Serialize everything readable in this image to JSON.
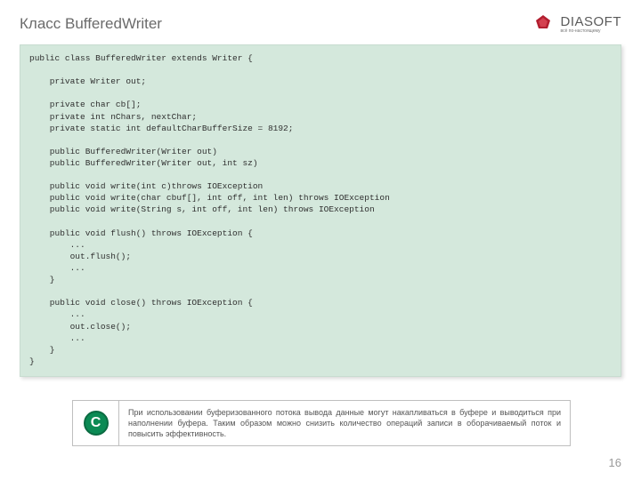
{
  "header": {
    "title": "Класс BufferedWriter",
    "logo_name": "DIASOFT",
    "logo_tagline": "всё по-настоящему"
  },
  "code": {
    "lines": [
      "public class BufferedWriter extends Writer {",
      "",
      "    private Writer out;",
      "",
      "    private char cb[];",
      "    private int nChars, nextChar;",
      "    private static int defaultCharBufferSize = 8192;",
      "",
      "    public BufferedWriter(Writer out)",
      "    public BufferedWriter(Writer out, int sz)",
      "",
      "    public void write(int c)throws IOException",
      "    public void write(char cbuf[], int off, int len) throws IOException",
      "    public void write(String s, int off, int len) throws IOException",
      "",
      "    public void flush() throws IOException {",
      "        ...",
      "        out.flush();",
      "        ...",
      "    }",
      "",
      "    public void close() throws IOException {",
      "        ...",
      "        out.close();",
      "        ...",
      "    }",
      "}"
    ]
  },
  "note": {
    "badge": "C",
    "text": "При использовании буферизованного потока вывода данные могут накапливаться в буфере и выводиться при наполнении буфера. Таким образом можно снизить количество операций записи в оборачиваемый поток и повысить эффективность."
  },
  "page_number": "16",
  "colors": {
    "logo_accent": "#b21e2f",
    "note_badge_bg": "#0b8a54"
  }
}
